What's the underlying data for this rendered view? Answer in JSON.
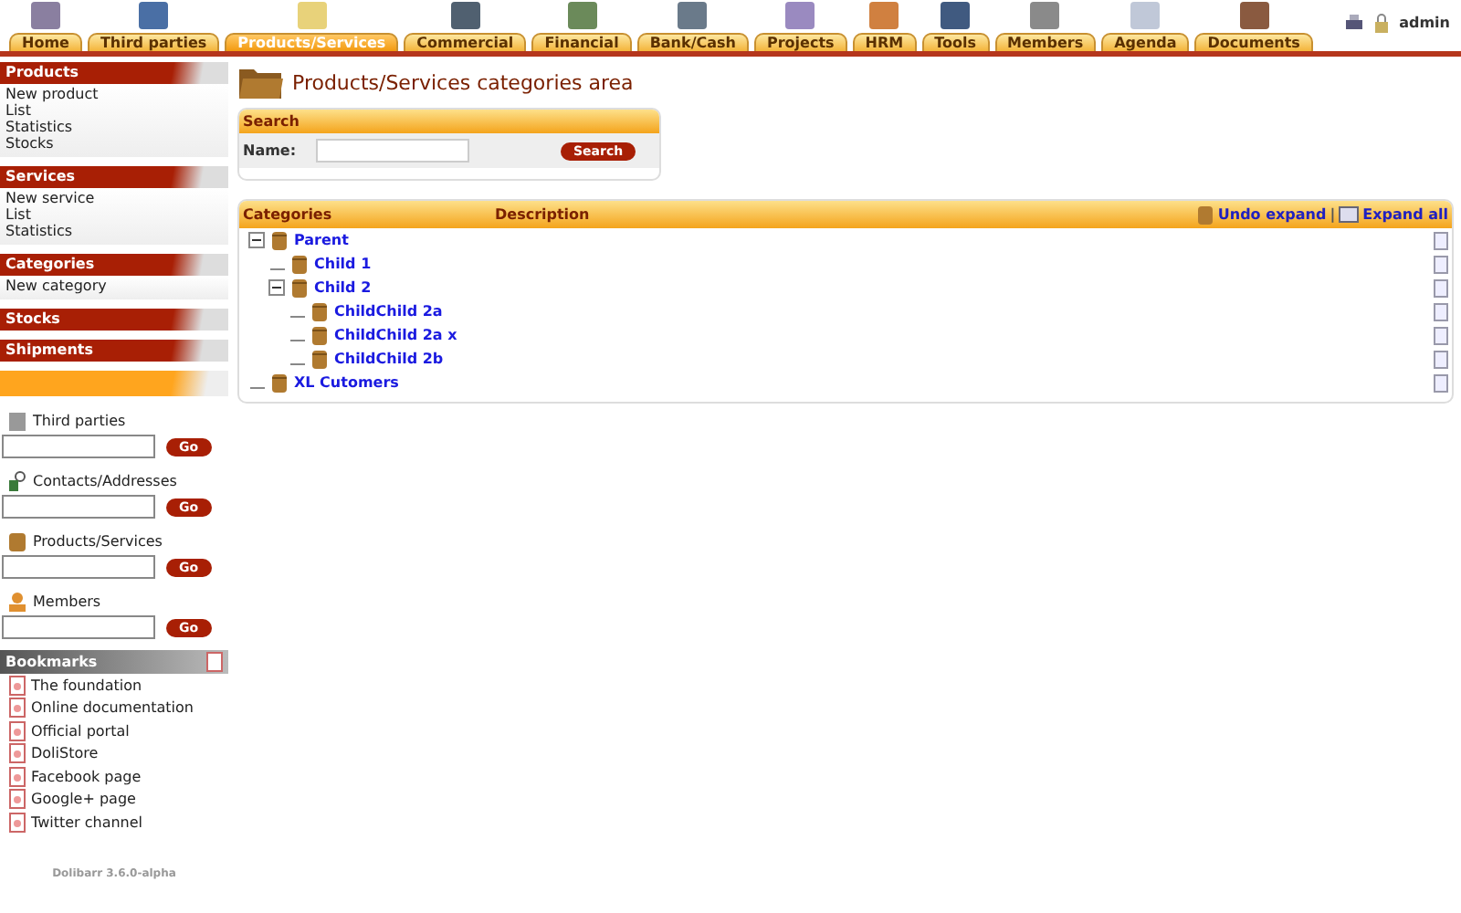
{
  "top_menu": [
    {
      "label": "Home",
      "selected": false
    },
    {
      "label": "Third parties",
      "selected": false
    },
    {
      "label": "Products/Services",
      "selected": true
    },
    {
      "label": "Commercial",
      "selected": false
    },
    {
      "label": "Financial",
      "selected": false
    },
    {
      "label": "Bank/Cash",
      "selected": false
    },
    {
      "label": "Projects",
      "selected": false
    },
    {
      "label": "HRM",
      "selected": false
    },
    {
      "label": "Tools",
      "selected": false
    },
    {
      "label": "Members",
      "selected": false
    },
    {
      "label": "Agenda",
      "selected": false
    },
    {
      "label": "Documents",
      "selected": false
    }
  ],
  "user": "admin",
  "sidebar": {
    "menus": [
      {
        "title": "Products",
        "items": [
          "New product",
          "List",
          "Statistics",
          "Stocks"
        ]
      },
      {
        "title": "Services",
        "items": [
          "New service",
          "List",
          "Statistics"
        ]
      },
      {
        "title": "Categories",
        "items": [
          "New category"
        ]
      },
      {
        "title": "Stocks"
      },
      {
        "title": "Shipments"
      }
    ],
    "searches": [
      {
        "kind": "company",
        "label": "Third parties",
        "button": "Go"
      },
      {
        "kind": "contact",
        "label": "Contacts/Addresses",
        "button": "Go"
      },
      {
        "kind": "product",
        "label": "Products/Services",
        "button": "Go"
      },
      {
        "kind": "member",
        "label": "Members",
        "button": "Go"
      }
    ],
    "bookmarks": {
      "title": "Bookmarks",
      "items": [
        "The foundation",
        "Online documentation",
        "Official portal",
        "DoliStore",
        "Facebook page",
        "Google+ page",
        "Twitter channel"
      ]
    },
    "version": "Dolibarr 3.6.0-alpha"
  },
  "page_title": "Products/Services categories area",
  "search_box": {
    "title": "Search",
    "label": "Name:",
    "button": "Search"
  },
  "tree": {
    "columns": [
      "Categories",
      "Description"
    ],
    "undo_expand": "Undo expand",
    "separator": "|",
    "expand_all": "Expand all",
    "nodes": [
      {
        "label": "Parent",
        "expanded": true,
        "children": [
          {
            "label": "Child 1"
          },
          {
            "label": "Child 2",
            "expanded": true,
            "children": [
              {
                "label": "ChildChild 2a"
              },
              {
                "label": "ChildChild 2a x"
              },
              {
                "label": "ChildChild 2b"
              }
            ]
          }
        ]
      },
      {
        "label": "XL Cutomers"
      }
    ]
  }
}
